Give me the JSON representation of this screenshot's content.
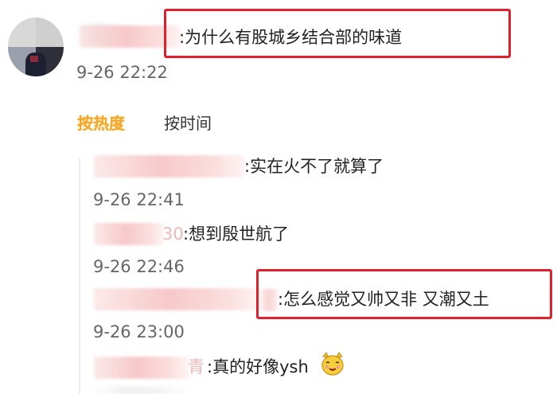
{
  "post": {
    "comment_text": ":为什么有股城乡结合部的味道",
    "timestamp": "9-26 22:22"
  },
  "sort_tabs": {
    "hot": "按热度",
    "time": "按时间"
  },
  "replies": [
    {
      "name_fragment": "",
      "text": ":实在火不了就算了",
      "timestamp": "9-26 22:41"
    },
    {
      "name_fragment": "30",
      "text": ":想到殷世航了",
      "timestamp": "9-26 22:46"
    },
    {
      "name_fragment": "",
      "text": ":怎么感觉又帅又非 又潮又土",
      "timestamp": "9-26 23:00"
    },
    {
      "name_fragment": "青",
      "text": ":真的好像ysh",
      "timestamp": ""
    }
  ],
  "emoji": "smirk-emoji-icon",
  "highlight_color": "#e0212b"
}
